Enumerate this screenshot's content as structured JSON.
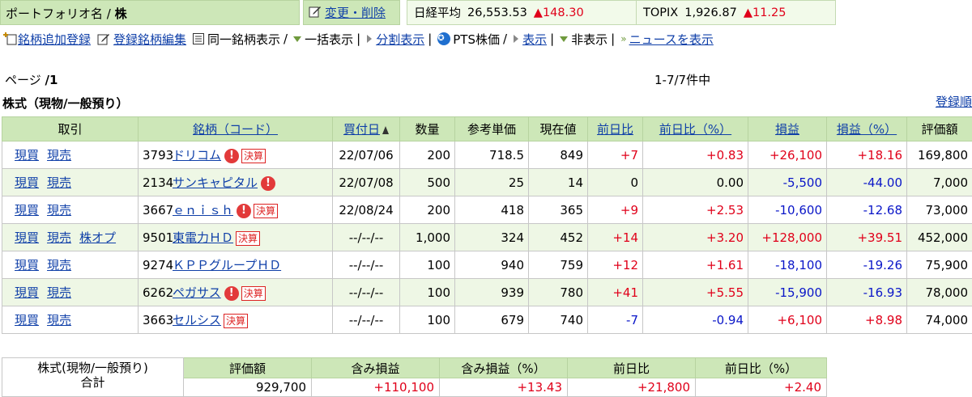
{
  "header": {
    "portfolio_label": "ポートフォリオ名 /",
    "portfolio_name": "株",
    "edit_delete": "変更・削除",
    "indices": [
      {
        "name": "日経平均",
        "value": "26,553.53",
        "change": "148.30"
      },
      {
        "name": "TOPIX",
        "value": "1,926.87",
        "change": "11.25"
      }
    ]
  },
  "toolbar": {
    "add": "銘柄追加登録",
    "edit": "登録銘柄編集",
    "same_brand": "同一銘柄表示",
    "bulk": "一括表示",
    "split": "分割表示",
    "pts": "PTS株価",
    "show": "表示",
    "hide": "非表示",
    "news": "ニュースを表示"
  },
  "page": {
    "label": "ページ",
    "number": "/1",
    "count": "1-7/7件中"
  },
  "section_title": "株式（現物/一般預り）",
  "sort_link": "登録順",
  "table": {
    "headers": {
      "trade": "取引",
      "brand": "銘柄（コード）",
      "buy_date": "買付日",
      "qty": "数量",
      "ref_price": "参考単価",
      "price": "現在値",
      "chg": "前日比",
      "chg_pct": "前日比（%）",
      "pl": "損益",
      "pl_pct": "損益（%）",
      "value": "評価額"
    },
    "rows": [
      {
        "actions": [
          "現買",
          "現売"
        ],
        "code": "3793",
        "name": "ドリコム",
        "ex": "!",
        "kessan": "決算",
        "date": "22/07/06",
        "qty": "200",
        "ref": "718.5",
        "price": "849",
        "chg": "+7",
        "chg_pct": "+0.83",
        "pl": "+26,100",
        "pl_pct": "+18.16",
        "value": "169,800"
      },
      {
        "actions": [
          "現買",
          "現売"
        ],
        "code": "2134",
        "name": "サンキャピタル",
        "ex": "!",
        "kessan": "",
        "date": "22/07/08",
        "qty": "500",
        "ref": "25",
        "price": "14",
        "chg": "0",
        "chg_pct": "0.00",
        "pl": "-5,500",
        "pl_pct": "-44.00",
        "value": "7,000"
      },
      {
        "actions": [
          "現買",
          "現売"
        ],
        "code": "3667",
        "name": "ｅｎｉｓｈ",
        "ex": "!",
        "kessan": "決算",
        "date": "22/08/24",
        "qty": "200",
        "ref": "418",
        "price": "365",
        "chg": "+9",
        "chg_pct": "+2.53",
        "pl": "-10,600",
        "pl_pct": "-12.68",
        "value": "73,000"
      },
      {
        "actions": [
          "現買",
          "現売",
          "株オプ"
        ],
        "code": "9501",
        "name": "東電力ＨＤ",
        "ex": "",
        "kessan": "決算",
        "date": "--/--/--",
        "qty": "1,000",
        "ref": "324",
        "price": "452",
        "chg": "+14",
        "chg_pct": "+3.20",
        "pl": "+128,000",
        "pl_pct": "+39.51",
        "value": "452,000"
      },
      {
        "actions": [
          "現買",
          "現売"
        ],
        "code": "9274",
        "name": "ＫＰＰグループＨＤ",
        "ex": "",
        "kessan": "",
        "date": "--/--/--",
        "qty": "100",
        "ref": "940",
        "price": "759",
        "chg": "+12",
        "chg_pct": "+1.61",
        "pl": "-18,100",
        "pl_pct": "-19.26",
        "value": "75,900"
      },
      {
        "actions": [
          "現買",
          "現売"
        ],
        "code": "6262",
        "name": "ペガサス",
        "ex": "!",
        "kessan": "決算",
        "date": "--/--/--",
        "qty": "100",
        "ref": "939",
        "price": "780",
        "chg": "+41",
        "chg_pct": "+5.55",
        "pl": "-15,900",
        "pl_pct": "-16.93",
        "value": "78,000"
      },
      {
        "actions": [
          "現買",
          "現売"
        ],
        "code": "3663",
        "name": "セルシス",
        "ex": "",
        "kessan": "決算",
        "date": "--/--/--",
        "qty": "100",
        "ref": "679",
        "price": "740",
        "chg": "-7",
        "chg_pct": "-0.94",
        "pl": "+6,100",
        "pl_pct": "+8.98",
        "value": "74,000"
      }
    ]
  },
  "summary": {
    "label_line1": "株式(現物/一般預り)",
    "label_line2": "合計",
    "headers": [
      "評価額",
      "含み損益",
      "含み損益（%）",
      "前日比",
      "前日比（%）"
    ],
    "values": [
      "929,700",
      "+110,100",
      "+13.43",
      "+21,800",
      "+2.40"
    ]
  },
  "colors": {
    "header_green": "#cde7b8",
    "row_alt": "#eef7e5",
    "positive": "#e0001a",
    "negative": "#0a16c8",
    "link": "#0f3fa8"
  },
  "icons": [
    "edit-icon",
    "add-icon",
    "list-icon",
    "triangle-down-icon",
    "triangle-right-icon",
    "globe-icon",
    "double-chevron-icon",
    "exclamation-icon",
    "sort-asc-icon"
  ]
}
